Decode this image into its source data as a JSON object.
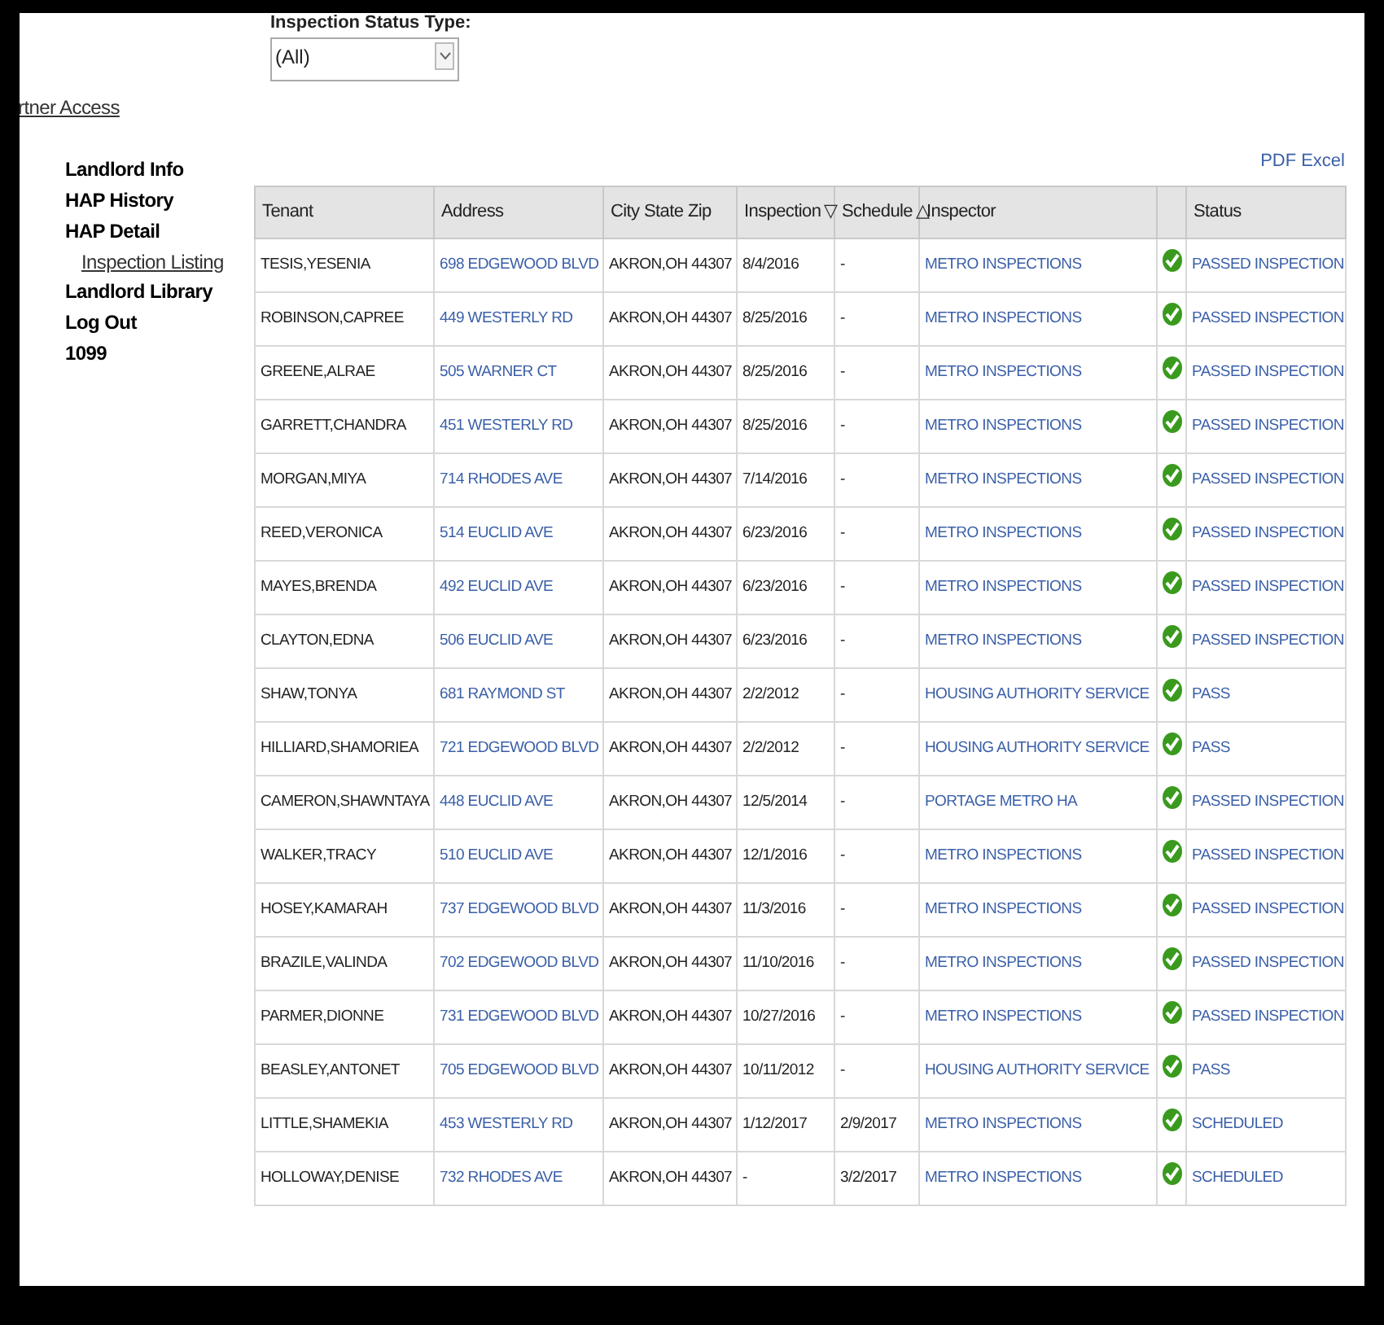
{
  "filter": {
    "label": "Inspection Status Type:",
    "value": "(All)"
  },
  "sidebar": {
    "heading": "rtner Access",
    "items": [
      {
        "label": "Landlord Info",
        "selected": false
      },
      {
        "label": "HAP History",
        "selected": false
      },
      {
        "label": "HAP Detail",
        "selected": false,
        "children": [
          {
            "label": "Inspection Listing",
            "selected": true
          }
        ]
      },
      {
        "label": "Landlord Library",
        "selected": false
      },
      {
        "label": "Log Out",
        "selected": false
      },
      {
        "label": "1099",
        "selected": false
      }
    ]
  },
  "export_links": [
    "PDF",
    "Excel"
  ],
  "table": {
    "columns": [
      {
        "label": "Tenant"
      },
      {
        "label": "Address"
      },
      {
        "label": "City State Zip"
      },
      {
        "label": "Inspection",
        "sort_mark": "▽"
      },
      {
        "label": "Schedule",
        "sort_mark": "△"
      },
      {
        "label": "Inspector"
      },
      {
        "label": "Status"
      }
    ],
    "rows": [
      {
        "tenant": "TESIS,YESENIA",
        "address": "698 EDGEWOOD BLVD",
        "city_state_zip": "AKRON,OH 44307",
        "inspection": "8/4/2016",
        "schedule": "-",
        "inspector": "METRO INSPECTIONS",
        "status": "PASSED INSPECTION"
      },
      {
        "tenant": "ROBINSON,CAPREE",
        "address": "449 WESTERLY RD",
        "city_state_zip": "AKRON,OH 44307",
        "inspection": "8/25/2016",
        "schedule": "-",
        "inspector": "METRO INSPECTIONS",
        "status": "PASSED INSPECTION"
      },
      {
        "tenant": "GREENE,ALRAE",
        "address": "505 WARNER CT",
        "city_state_zip": "AKRON,OH 44307",
        "inspection": "8/25/2016",
        "schedule": "-",
        "inspector": "METRO INSPECTIONS",
        "status": "PASSED INSPECTION"
      },
      {
        "tenant": "GARRETT,CHANDRA",
        "address": "451 WESTERLY RD",
        "city_state_zip": "AKRON,OH 44307",
        "inspection": "8/25/2016",
        "schedule": "-",
        "inspector": "METRO INSPECTIONS",
        "status": "PASSED INSPECTION"
      },
      {
        "tenant": "MORGAN,MIYA",
        "address": "714 RHODES AVE",
        "city_state_zip": "AKRON,OH 44307",
        "inspection": "7/14/2016",
        "schedule": "-",
        "inspector": "METRO INSPECTIONS",
        "status": "PASSED INSPECTION"
      },
      {
        "tenant": "REED,VERONICA",
        "address": "514 EUCLID AVE",
        "city_state_zip": "AKRON,OH 44307",
        "inspection": "6/23/2016",
        "schedule": "-",
        "inspector": "METRO INSPECTIONS",
        "status": "PASSED INSPECTION"
      },
      {
        "tenant": "MAYES,BRENDA",
        "address": "492 EUCLID AVE",
        "city_state_zip": "AKRON,OH 44307",
        "inspection": "6/23/2016",
        "schedule": "-",
        "inspector": "METRO INSPECTIONS",
        "status": "PASSED INSPECTION"
      },
      {
        "tenant": "CLAYTON,EDNA",
        "address": "506 EUCLID AVE",
        "city_state_zip": "AKRON,OH 44307",
        "inspection": "6/23/2016",
        "schedule": "-",
        "inspector": "METRO INSPECTIONS",
        "status": "PASSED INSPECTION"
      },
      {
        "tenant": "SHAW,TONYA",
        "address": "681 RAYMOND ST",
        "city_state_zip": "AKRON,OH 44307",
        "inspection": "2/2/2012",
        "schedule": "-",
        "inspector": "HOUSING AUTHORITY SERVICE",
        "status": "PASS"
      },
      {
        "tenant": "HILLIARD,SHAMORIEA",
        "address": "721 EDGEWOOD BLVD",
        "city_state_zip": "AKRON,OH 44307",
        "inspection": "2/2/2012",
        "schedule": "-",
        "inspector": "HOUSING AUTHORITY SERVICE",
        "status": "PASS"
      },
      {
        "tenant": "CAMERON,SHAWNTAYA",
        "address": "448 EUCLID AVE",
        "city_state_zip": "AKRON,OH 44307",
        "inspection": "12/5/2014",
        "schedule": "-",
        "inspector": "PORTAGE METRO HA",
        "status": "PASSED INSPECTION"
      },
      {
        "tenant": "WALKER,TRACY",
        "address": "510 EUCLID AVE",
        "city_state_zip": "AKRON,OH 44307",
        "inspection": "12/1/2016",
        "schedule": "-",
        "inspector": "METRO INSPECTIONS",
        "status": "PASSED INSPECTION"
      },
      {
        "tenant": "HOSEY,KAMARAH",
        "address": "737 EDGEWOOD BLVD",
        "city_state_zip": "AKRON,OH 44307",
        "inspection": "11/3/2016",
        "schedule": "-",
        "inspector": "METRO INSPECTIONS",
        "status": "PASSED INSPECTION"
      },
      {
        "tenant": "BRAZILE,VALINDA",
        "address": "702 EDGEWOOD BLVD",
        "city_state_zip": "AKRON,OH 44307",
        "inspection": "11/10/2016",
        "schedule": "-",
        "inspector": "METRO INSPECTIONS",
        "status": "PASSED INSPECTION"
      },
      {
        "tenant": "PARMER,DIONNE",
        "address": "731 EDGEWOOD BLVD",
        "city_state_zip": "AKRON,OH 44307",
        "inspection": "10/27/2016",
        "schedule": "-",
        "inspector": "METRO INSPECTIONS",
        "status": "PASSED INSPECTION"
      },
      {
        "tenant": "BEASLEY,ANTONET",
        "address": "705 EDGEWOOD BLVD",
        "city_state_zip": "AKRON,OH 44307",
        "inspection": "10/11/2012",
        "schedule": "-",
        "inspector": "HOUSING AUTHORITY SERVICE",
        "status": "PASS"
      },
      {
        "tenant": "LITTLE,SHAMEKIA",
        "address": "453 WESTERLY RD",
        "city_state_zip": "AKRON,OH 44307",
        "inspection": "1/12/2017",
        "schedule": "2/9/2017",
        "inspector": "METRO INSPECTIONS",
        "status": "SCHEDULED"
      },
      {
        "tenant": "HOLLOWAY,DENISE",
        "address": "732 RHODES AVE",
        "city_state_zip": "AKRON,OH 44307",
        "inspection": "-",
        "schedule": "3/2/2017",
        "inspector": "METRO INSPECTIONS",
        "status": "SCHEDULED"
      }
    ]
  }
}
